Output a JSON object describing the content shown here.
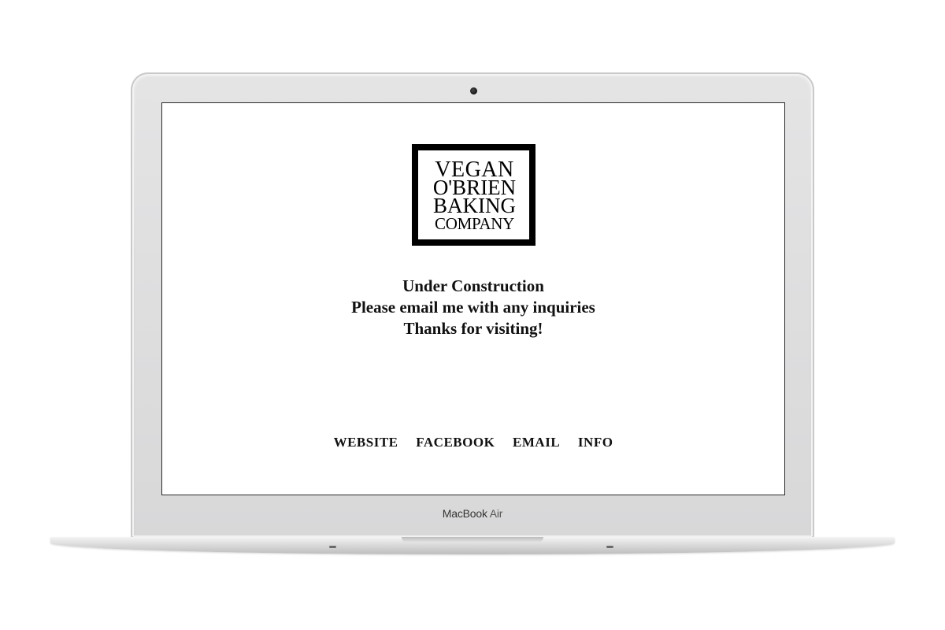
{
  "device": {
    "brand_name": "MacBook",
    "model_suffix": "Air"
  },
  "logo": {
    "lines": [
      "VEGAN",
      "O'BRIEN",
      "BAKING",
      "COMPANY"
    ]
  },
  "message": {
    "line1": "Under Construction",
    "line2": "Please email me with any inquiries",
    "line3": "Thanks for visiting!"
  },
  "nav": {
    "items": [
      {
        "label": "WEBSITE"
      },
      {
        "label": "FACEBOOK"
      },
      {
        "label": "EMAIL"
      },
      {
        "label": "INFO"
      }
    ]
  },
  "colors": {
    "text": "#111111",
    "frame": "#dcdcdd",
    "logo_bg": "#000000"
  }
}
